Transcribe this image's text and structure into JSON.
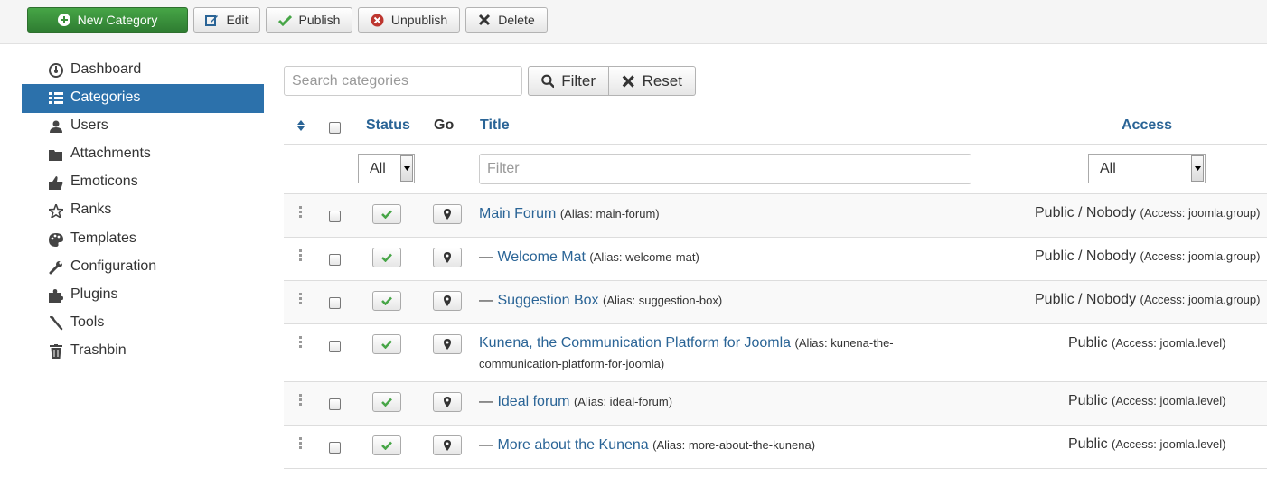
{
  "toolbar": {
    "new_label": "New Category",
    "edit_label": "Edit",
    "publish_label": "Publish",
    "unpublish_label": "Unpublish",
    "delete_label": "Delete"
  },
  "sidebar": {
    "items": [
      {
        "label": "Dashboard",
        "icon": "dashboard-icon"
      },
      {
        "label": "Categories",
        "icon": "list-icon",
        "active": true
      },
      {
        "label": "Users",
        "icon": "user-icon"
      },
      {
        "label": "Attachments",
        "icon": "folder-icon"
      },
      {
        "label": "Emoticons",
        "icon": "thumbs-up-icon"
      },
      {
        "label": "Ranks",
        "icon": "star-icon"
      },
      {
        "label": "Templates",
        "icon": "palette-icon"
      },
      {
        "label": "Configuration",
        "icon": "wrench-icon"
      },
      {
        "label": "Plugins",
        "icon": "puzzle-icon"
      },
      {
        "label": "Tools",
        "icon": "tools-icon"
      },
      {
        "label": "Trashbin",
        "icon": "trash-icon"
      }
    ]
  },
  "search": {
    "placeholder": "Search categories",
    "filter_label": "Filter",
    "reset_label": "Reset"
  },
  "table": {
    "headers": {
      "status": "Status",
      "go": "Go",
      "title": "Title",
      "access": "Access"
    },
    "filters": {
      "status_value": "All",
      "title_placeholder": "Filter",
      "access_value": "All"
    },
    "rows": [
      {
        "indent": "",
        "title": "Main Forum",
        "alias": "(Alias: main-forum)",
        "access": "Public / Nobody",
        "access_type": "(Access: joomla.group)"
      },
      {
        "indent": "— ",
        "title": "Welcome Mat",
        "alias": "(Alias: welcome-mat)",
        "access": "Public / Nobody",
        "access_type": "(Access: joomla.group)"
      },
      {
        "indent": "— ",
        "title": "Suggestion Box",
        "alias": "(Alias: suggestion-box)",
        "access": "Public / Nobody",
        "access_type": "(Access: joomla.group)"
      },
      {
        "indent": "",
        "title": "Kunena, the Communication Platform for Joomla",
        "alias": "(Alias: kunena-the-communication-platform-for-joomla)",
        "access": "Public",
        "access_type": "(Access: joomla.level)"
      },
      {
        "indent": "— ",
        "title": "Ideal forum",
        "alias": "(Alias: ideal-forum)",
        "access": "Public",
        "access_type": "(Access: joomla.level)"
      },
      {
        "indent": "— ",
        "title": "More about the Kunena",
        "alias": "(Alias: more-about-the-kunena)",
        "access": "Public",
        "access_type": "(Access: joomla.level)"
      }
    ]
  },
  "colors": {
    "accent": "#2c71ab",
    "link": "#2a6496",
    "publish_green": "#46a546",
    "unpublish_red": "#c0392b"
  }
}
